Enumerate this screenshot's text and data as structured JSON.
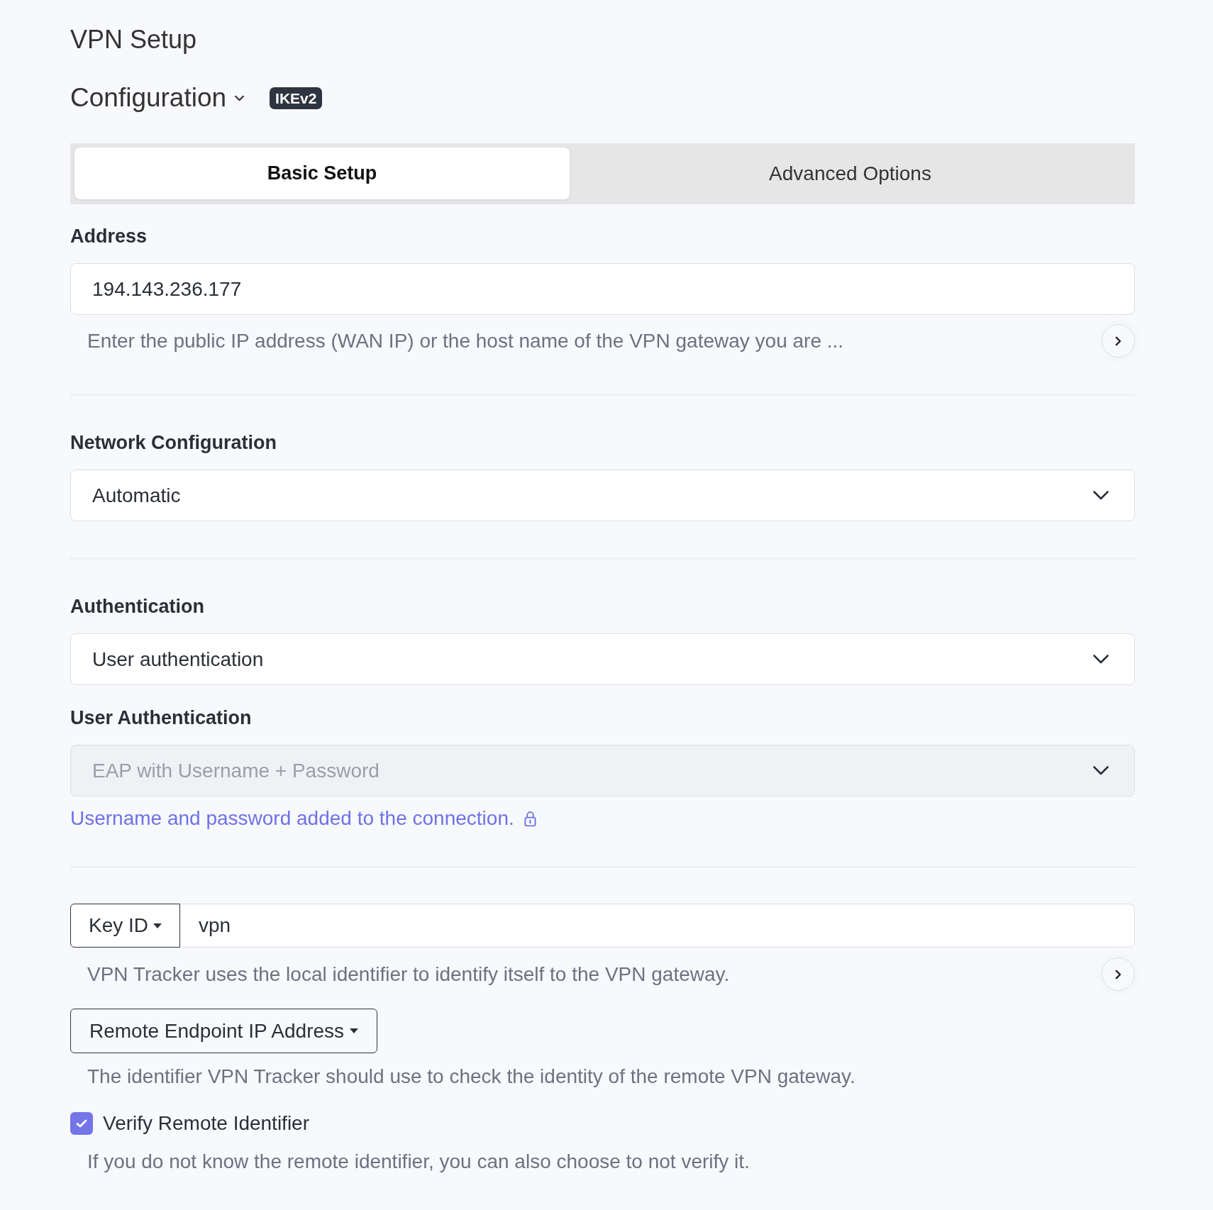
{
  "header": {
    "title": "VPN Setup",
    "configuration": "Configuration",
    "badge": "IKEv2"
  },
  "tabs": [
    {
      "label": "Basic Setup",
      "selected": true
    },
    {
      "label": "Advanced Options",
      "selected": false
    }
  ],
  "sections": [
    {
      "items": [
        {
          "kind": "label",
          "text": "Address"
        },
        {
          "kind": "input",
          "value": "194.143.236.177"
        },
        {
          "kind": "hint",
          "text": "Enter the public IP address (WAN IP) or the host name of the VPN gateway you are ...",
          "expandable": true
        }
      ]
    },
    {
      "items": [
        {
          "kind": "label",
          "text": "Network Configuration"
        },
        {
          "kind": "select",
          "value": "Automatic",
          "disabled": false
        }
      ]
    },
    {
      "items": [
        {
          "kind": "label",
          "text": "Authentication"
        },
        {
          "kind": "select",
          "value": "User authentication",
          "disabled": false
        },
        {
          "kind": "label",
          "text": "User Authentication"
        },
        {
          "kind": "select",
          "value": "EAP with Username + Password",
          "disabled": true
        },
        {
          "kind": "note",
          "text": "Username and password added to the connection."
        }
      ]
    },
    {
      "items": [
        {
          "kind": "identifier",
          "type": "Key ID",
          "value": "vpn"
        },
        {
          "kind": "hint",
          "text": "VPN Tracker uses the local identifier to identify itself to the VPN gateway.",
          "expandable": true
        },
        {
          "kind": "dropdown",
          "label": "Remote Endpoint IP Address"
        },
        {
          "kind": "hint",
          "text": "The identifier VPN Tracker should use to check the identity of the remote VPN gateway.",
          "expandable": false
        },
        {
          "kind": "checkbox",
          "label": "Verify Remote Identifier",
          "checked": true
        },
        {
          "kind": "hint",
          "text": "If you do not know the remote identifier, you can also choose to not verify it.",
          "expandable": false
        }
      ]
    }
  ]
}
